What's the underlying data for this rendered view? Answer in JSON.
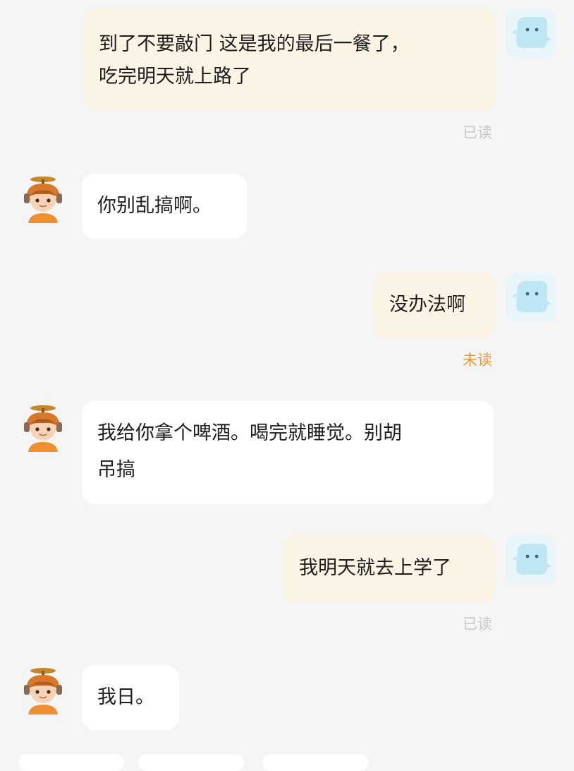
{
  "messages": [
    {
      "side": "out",
      "text": "到了不要敲门 这是我的最后一餐了，\n吃完明天就上路了",
      "status": "已读"
    },
    {
      "side": "in",
      "text": "你别乱搞啊。"
    },
    {
      "side": "out",
      "text": "没办法啊",
      "status": "未读"
    },
    {
      "side": "in",
      "text": "我给你拿个啤酒。喝完就睡觉。别胡\n吊搞"
    },
    {
      "side": "out",
      "text": "我明天就去上学了",
      "status": "已读"
    },
    {
      "side": "in",
      "text": "我日。"
    }
  ],
  "colors": {
    "outgoing_bubble": "#fbf3e3",
    "incoming_bubble": "#ffffff",
    "read_status": "#c8c8c8",
    "unread_status": "#e89a3a",
    "background": "#f5f5f5"
  },
  "icons": {
    "self_avatar": "blue-blob-avatar-icon",
    "other_avatar": "propeller-cap-kid-avatar-icon"
  }
}
